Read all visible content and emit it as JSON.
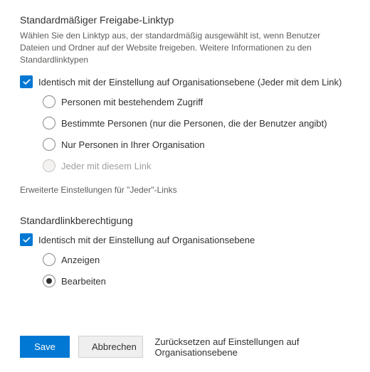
{
  "section1": {
    "heading": "Standardmäßiger Freigabe-Linktyp",
    "description": "Wählen Sie den Linktyp aus, der standardmäßig ausgewählt ist, wenn Benutzer Dateien und Ordner auf der Website freigeben. Weitere Informationen zu den Standardlinktypen",
    "checkbox_label": "Identisch mit der Einstellung auf Organisationsebene (Jeder mit dem Link)",
    "radios": {
      "r0": "Personen mit bestehendem Zugriff",
      "r1": "Bestimmte Personen (nur die Personen, die der Benutzer angibt)",
      "r2": "Nur Personen in Ihrer Organisation",
      "r3": "Jeder mit diesem Link"
    },
    "advanced_link": "Erweiterte Einstellungen für \"Jeder\"-Links"
  },
  "section2": {
    "heading": "Standardlinkberechtigung",
    "checkbox_label": "Identisch mit der Einstellung auf Organisationsebene",
    "radios": {
      "r0": "Anzeigen",
      "r1": "Bearbeiten"
    }
  },
  "footer": {
    "save": "Save",
    "cancel": "Abbrechen",
    "reset": "Zurücksetzen auf Einstellungen auf Organisationsebene"
  }
}
